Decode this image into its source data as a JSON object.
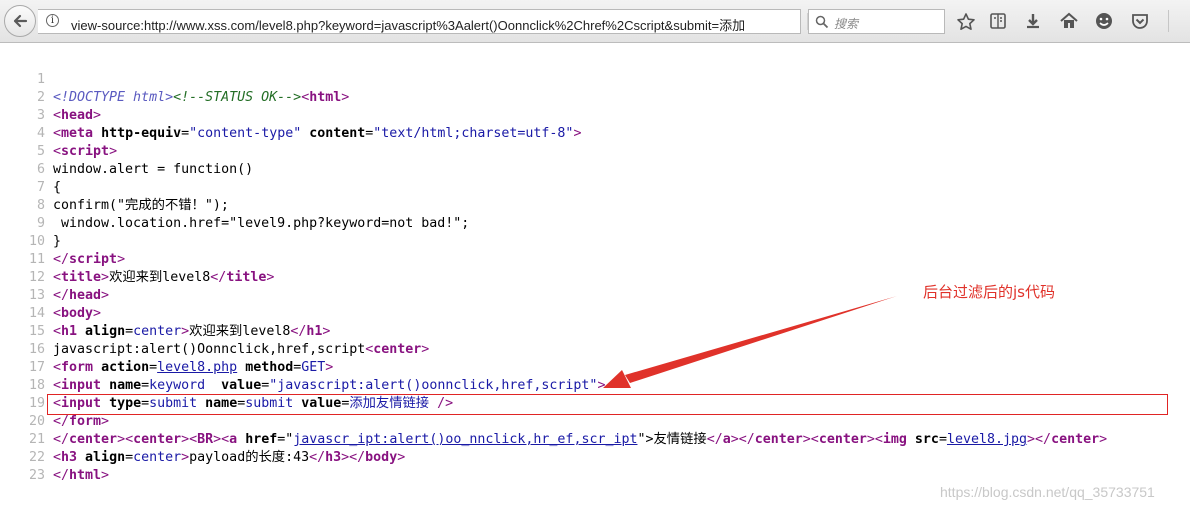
{
  "browser": {
    "url": "view-source:http://www.xss.com/level8.php?keyword=javascript%3Aalert()Oonnclick%2Chref%2Cscript&submit=添加",
    "search_placeholder": "搜索"
  },
  "source": {
    "line_numbers": [
      "1",
      "2",
      "3",
      "4",
      "5",
      "6",
      "7",
      "8",
      "9",
      "10",
      "11",
      "12",
      "13",
      "14",
      "15",
      "16",
      "17",
      "18",
      "19",
      "20",
      "21",
      "22",
      "23"
    ],
    "l1": {
      "doctype": "<!DOCTYPE html>",
      "comment": "<!--STATUS OK-->",
      "t1": "<",
      "tn": "html",
      "t2": ">"
    },
    "l2": {
      "t1": "<",
      "tn": "head",
      "t2": ">"
    },
    "l3": {
      "t1": "<",
      "tn": "meta",
      "a1": "http-equiv",
      "eq1": "=",
      "v1": "\"content-type\"",
      "a2": "content",
      "eq2": "=",
      "v2": "\"text/html;charset=utf-8\"",
      "t2": ">"
    },
    "l4": {
      "t1": "<",
      "tn": "script",
      "t2": ">"
    },
    "l5": "window.alert = function()",
    "l6": "{",
    "l7": "confirm(\"完成的不错！\");",
    "l8": " window.location.href=\"level9.php?keyword=not bad!\";",
    "l9": "}",
    "l10": {
      "t1": "</",
      "tn": "script",
      "t2": ">"
    },
    "l11": {
      "t1": "<",
      "tn": "title",
      "t2": ">",
      "text": "欢迎来到level8",
      "t3": "</",
      "tn2": "title",
      "t4": ">"
    },
    "l12": {
      "t1": "</",
      "tn": "head",
      "t2": ">"
    },
    "l13": {
      "t1": "<",
      "tn": "body",
      "t2": ">"
    },
    "l14": {
      "t1": "<",
      "tn": "h1",
      "a1": "align",
      "eq1": "=",
      "v1": "center",
      "t2": ">",
      "text": "欢迎来到level8",
      "t3": "</",
      "tn2": "h1",
      "t4": ">"
    },
    "l15": {
      "text": "javascript:alert()Oonnclick,href,script",
      "t1": "<",
      "tn": "center",
      "t2": ">"
    },
    "l16": {
      "t1": "<",
      "tn": "form",
      "a1": "action",
      "eq1": "=",
      "v1": "level8.php",
      "a2": "method",
      "eq2": "=",
      "v2": "GET",
      "t2": ">"
    },
    "l17": {
      "t1": "<",
      "tn": "input",
      "a1": "name",
      "eq1": "=",
      "v1": "keyword",
      "a2": "value",
      "eq2": "=",
      "v2": "\"javascript:alert()oonnclick,href,script\"",
      "t2": ">"
    },
    "l18": {
      "t1": "<",
      "tn": "input",
      "a1": "type",
      "eq1": "=",
      "v1": "submit",
      "a2": "name",
      "eq2": "=",
      "v2": "submit",
      "a3": "value",
      "eq3": "=",
      "v3": "添加友情链接",
      "t2": " />"
    },
    "l19": {
      "t1": "</",
      "tn": "form",
      "t2": ">"
    },
    "l20": {
      "p1": "</",
      "p2": "center",
      "p3": "><",
      "p4": "center",
      "p5": "><",
      "p6": "BR",
      "p7": "><",
      "p8": "a",
      "a1": "href",
      "eq1": "=\"",
      "v1": "javascr_ipt:alert()oo_nnclick,hr_ef,scr_ipt",
      "q1": "\">",
      "text": "友情链接",
      "p9": "</",
      "p10": "a",
      "p11": "></",
      "p12": "center",
      "p13": "><",
      "p14": "center",
      "p15": "><",
      "p16": "img",
      "a2": "src",
      "eq2": "=",
      "v2": "level8.jpg",
      "p17": "></",
      "p18": "center",
      "p19": ">"
    },
    "l21": {
      "t1": "<",
      "tn": "h3",
      "a1": "align",
      "eq1": "=",
      "v1": "center",
      "t2": ">",
      "text": "payload的长度:43",
      "t3": "</",
      "tn2": "h3",
      "t4": "></",
      "tn3": "body",
      "t5": ">"
    },
    "l22": {
      "t1": "</",
      "tn": "html",
      "t2": ">"
    }
  },
  "annotation": {
    "label": "后台过滤后的js代码",
    "color": "#e0322a"
  },
  "watermark": "https://blog.csdn.net/qq_35733751"
}
